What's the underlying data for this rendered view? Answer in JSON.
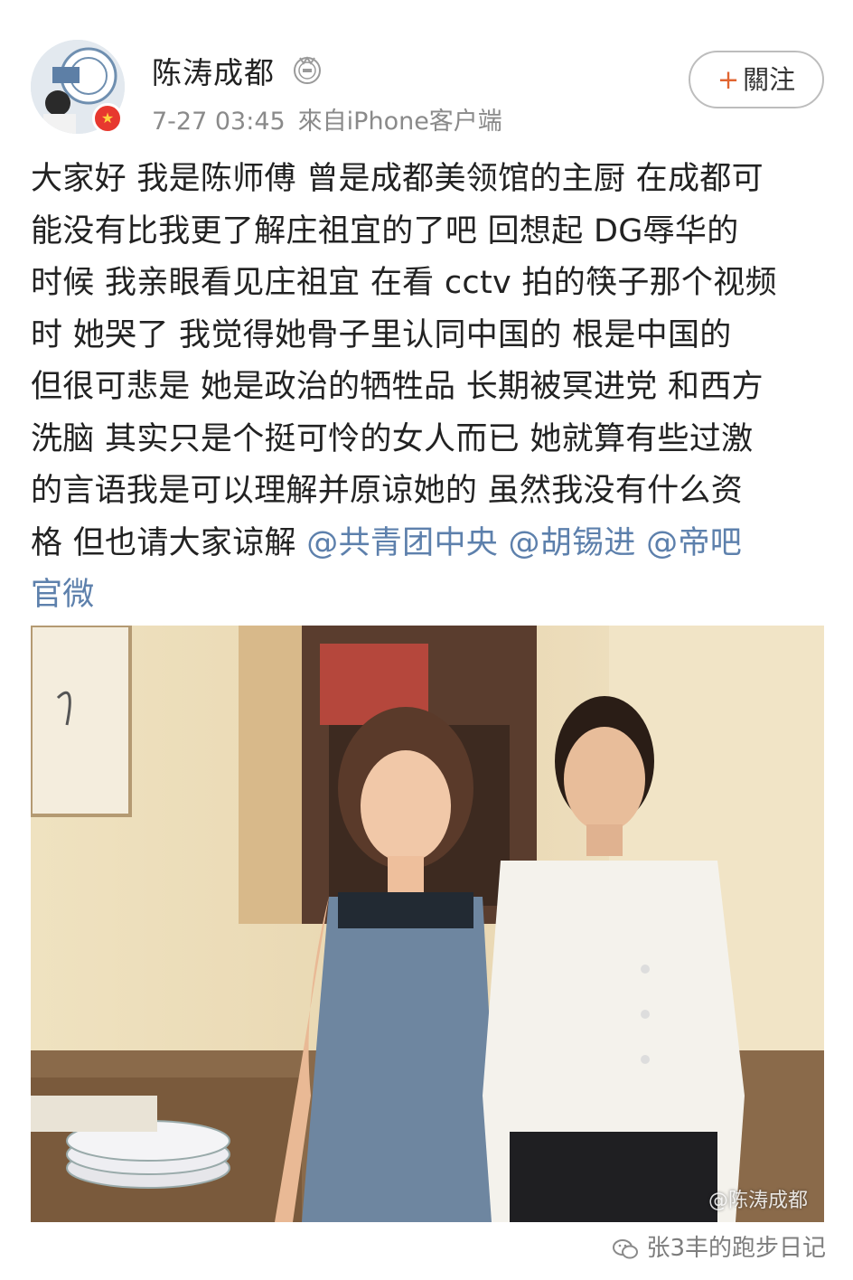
{
  "post": {
    "author": "陈涛成都",
    "time": "7-27 03:45",
    "source": "來自iPhone客户端",
    "follow_plus": "+",
    "follow_label": "關注",
    "lines": [
      "大家好 我是陈师傅 曾是成都美领馆的主厨 在成都可",
      "能没有比我更了解庄祖宜的了吧  回想起 DG辱华的",
      "时候 我亲眼看见庄祖宜 在看 cctv 拍的筷子那个视频",
      "时 她哭了 我觉得她骨子里认同中国的 根是中国的",
      "但很可悲是 她是政治的牺牲品 长期被冥进党 和西方",
      "洗脑 其实只是个挺可怜的女人而已 她就算有些过激",
      "的言语我是可以理解并原谅她的  虽然我没有什么资"
    ],
    "line8_text": "格 但也请大家谅解 ",
    "mentions": [
      "@共青团中央",
      "@胡锡进",
      "@帝吧"
    ],
    "mention_tail": "官微",
    "image_watermark": "@陈涛成都"
  },
  "footer": {
    "watermark": "张3丰的跑步日记"
  },
  "icons": {
    "vip": "medal-icon",
    "avatar_badge": "star-badge-icon",
    "wechat": "wechat-icon"
  },
  "colors": {
    "mention": "#5d80ac",
    "meta": "#8a8a8a",
    "follow_plus": "#e16531"
  }
}
